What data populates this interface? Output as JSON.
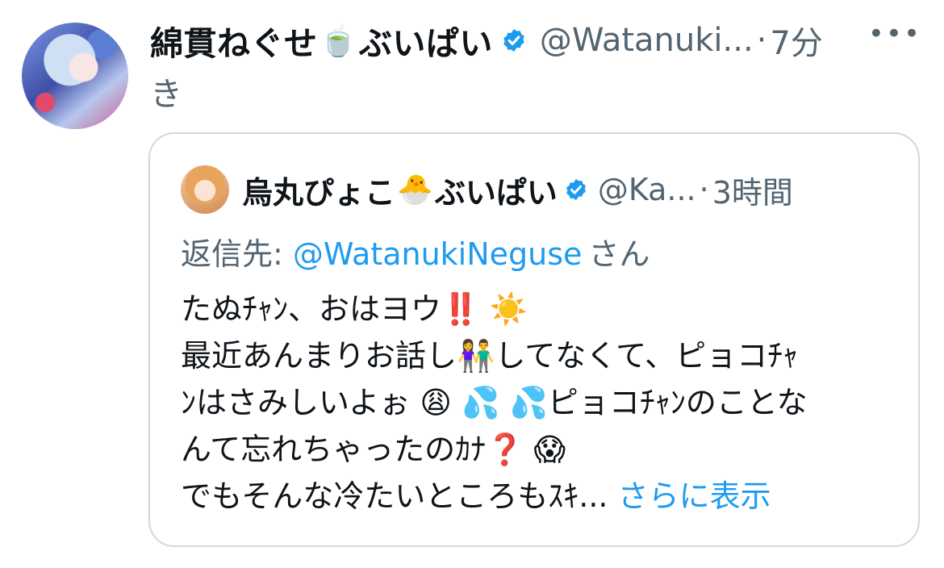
{
  "author": {
    "name": "綿貫ねぐせ",
    "name_emoji": "🍵",
    "name_suffix": "ぶいぱい",
    "handle": "@Watanuki...",
    "separator": "·",
    "time_part1": "7分",
    "time_part2": "き"
  },
  "more_icon": "more-horizontal-icon",
  "quoted": {
    "name": "烏丸ぴょこ",
    "name_emoji": "🐣",
    "name_suffix": "ぶいぱい",
    "handle": "@Ka...",
    "separator": "·",
    "time": "3時間",
    "reply_prefix": "返信先: ",
    "reply_mention": "@WatanukiNeguse",
    "reply_suffix": "さん",
    "body": {
      "l1_text": "たぬﾁｬﾝ、おはヨウ",
      "l1_e1": "‼️",
      "l1_e2": "☀️",
      "l2_text_a": "最近あんまりお話し",
      "l2_e1": "👫",
      "l2_text_b": "してなくて、ピョコﾁｬ",
      "l3_text_a": "ﾝはさみしいよぉ",
      "l3_e1": "😩",
      "l3_e2": "💦",
      "l3_e3": "💦",
      "l3_text_b": "ピョコﾁｬﾝのことな",
      "l4_text": "んて忘れちゃったのｶﾅ",
      "l4_e1": "❓",
      "l4_e2": "😱",
      "l5_text": "でもそんな冷たいところもｽｷ...",
      "show_more": " さらに表示"
    }
  },
  "colors": {
    "verified": "#1d9bf0",
    "link": "#1d9bf0",
    "secondary": "#536471"
  }
}
